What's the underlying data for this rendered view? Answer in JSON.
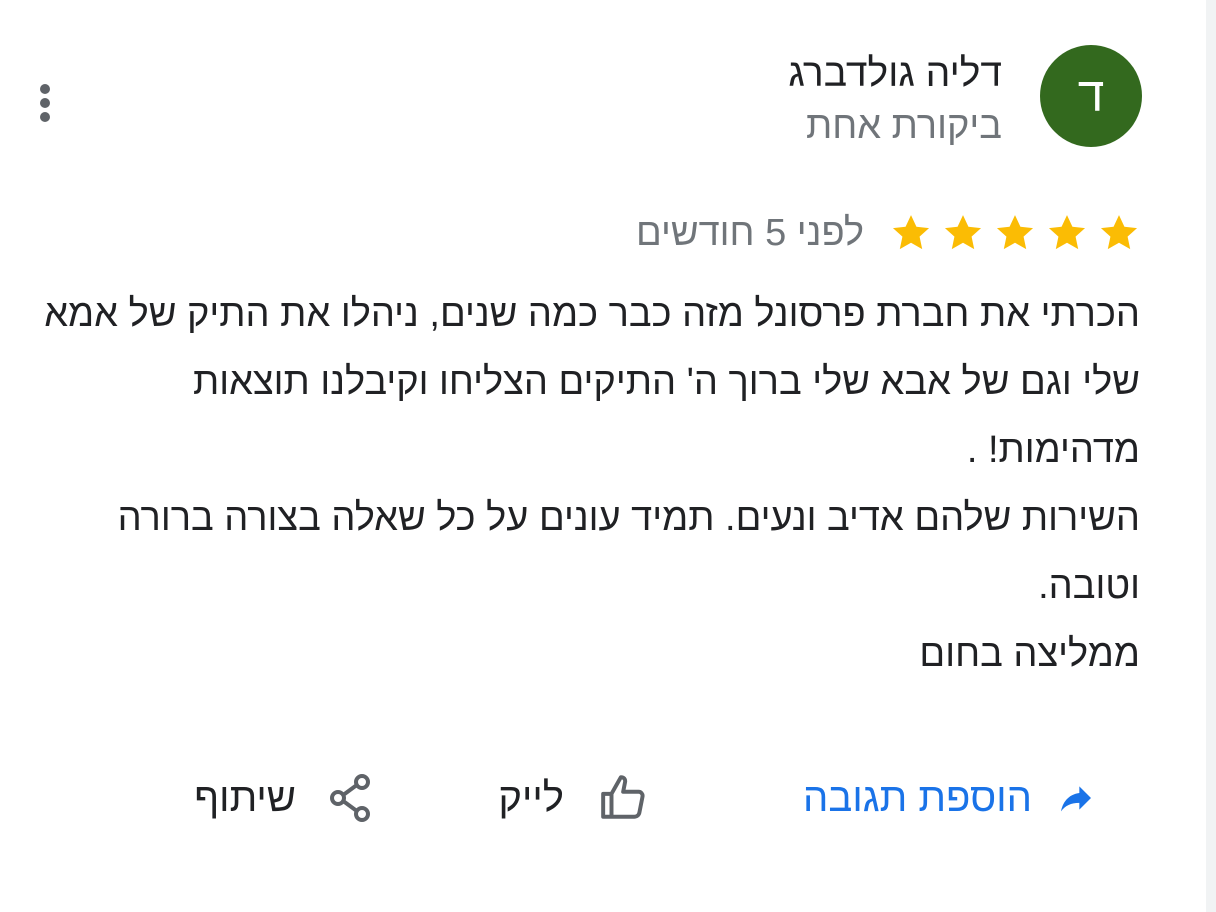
{
  "author": {
    "avatar_letter": "ד",
    "avatar_color": "#33691e",
    "name": "דליה גולדברג",
    "reviews_count_label": "ביקורת אחת"
  },
  "review": {
    "rating": 5,
    "max_rating": 5,
    "star_color": "#fbbc04",
    "relative_date": "לפני 5 חודשים",
    "lines": [
      "הכרתי את חברת פרסונל מזה כבר כמה שנים, ניהלו את התיק של אמא שלי וגם של אבא שלי ברוך ה' התיקים הצליחו וקיבלנו תוצאות מדהימות! .",
      "השירות שלהם אדיב ונעים. תמיד עונים על כל שאלה בצורה ברורה וטובה.",
      "ממליצה בחום"
    ]
  },
  "actions": {
    "reply_label": "הוספת תגובה",
    "like_label": "לייק",
    "share_label": "שיתוף",
    "reply_color": "#1a73e8"
  },
  "icons": {
    "menu": "more-vert-icon",
    "reply": "reply-icon",
    "like": "thumb-up-icon",
    "share": "share-icon",
    "star": "star-icon"
  }
}
